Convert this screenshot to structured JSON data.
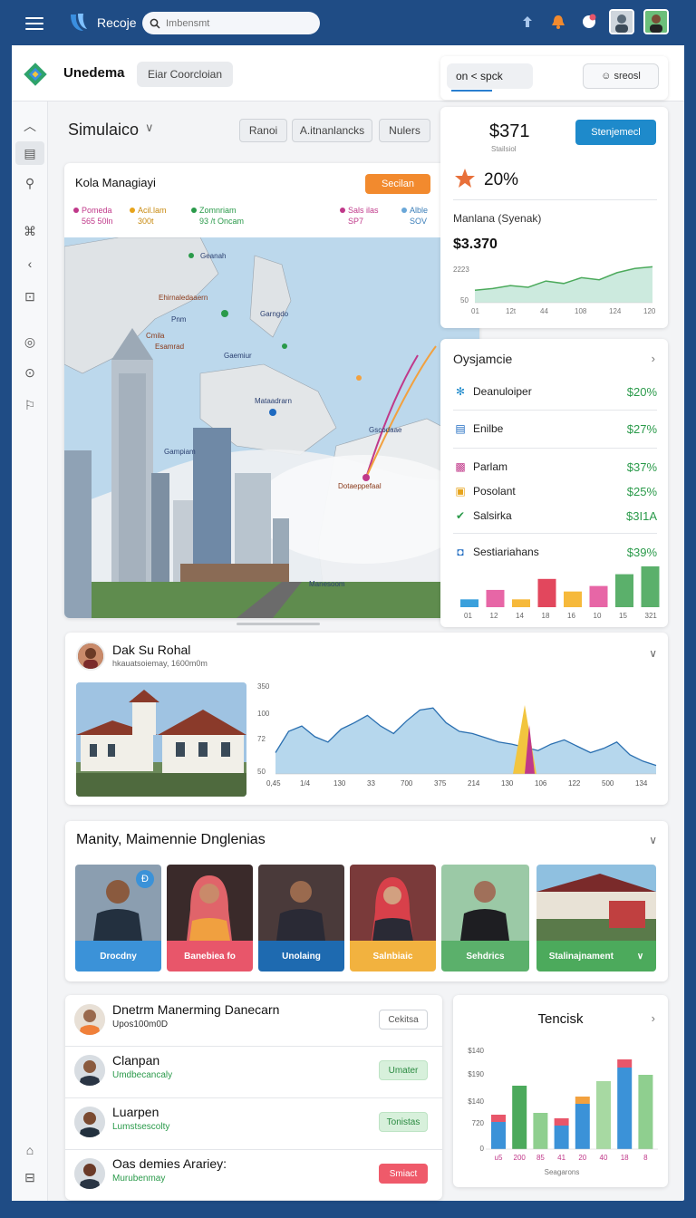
{
  "topbar": {
    "brand": "Recoje",
    "search_placeholder": "Imbensmt"
  },
  "header": {
    "title": "Unedema",
    "tab": "Eiar Coorcloian"
  },
  "page": {
    "title": "Simulaico",
    "filters": [
      "Ranoi",
      "A.itnanlancks",
      "Nulers"
    ]
  },
  "map_card": {
    "title": "Kola Managiayi",
    "button": "Secilan",
    "legend": [
      {
        "label": "Pomeda",
        "value": "565 50ln",
        "color": "#c0398a"
      },
      {
        "label": "Acil.lam",
        "value": "300t",
        "color": "#e7a41c"
      },
      {
        "label": "Zomnriam",
        "value": "93 /t Oncam",
        "color": "#2a9a4a"
      },
      {
        "label": "Sals ilas",
        "value": "SP7",
        "color": "#c0398a"
      },
      {
        "label": "Alble",
        "value": "SOV",
        "color": "#6aa7d8"
      }
    ],
    "labels": [
      "Geanah",
      "Ehirnaledaaern",
      "Pnm",
      "Garngdo",
      "Cmila",
      "Esamrad",
      "Gaemiur",
      "Mataadrarn",
      "Gscodaae",
      "Gampiam",
      "Dotaeppefaal",
      "Manesoom"
    ]
  },
  "right_tabs": {
    "tab": "on  < spck",
    "select": "☺ sreosl"
  },
  "stat_card": {
    "big_value": "$371",
    "big_sub": "Stailsiol",
    "button": "Stenjemecl",
    "percent": "20%",
    "label": "Manlana (Syenak)",
    "value": "$3.370",
    "y_ticks": [
      "2223",
      "50"
    ],
    "x_ticks": [
      "01",
      "12t",
      "44",
      "108",
      "124",
      "120"
    ],
    "series": [
      30,
      34,
      41,
      37,
      52,
      46,
      60,
      55,
      72,
      82,
      86
    ]
  },
  "list_card": {
    "title": "Oysjamcie",
    "items": [
      {
        "icon": "✻",
        "icon_color": "#1e8acb",
        "label": "Deanuloiper",
        "value": "$20%"
      },
      {
        "icon": "▤",
        "icon_color": "#1e6ac0",
        "label": "Enilbe",
        "value": "$27%"
      },
      {
        "icon": "▩",
        "icon_color": "#c0398a",
        "label": "Parlam",
        "value": "$37%"
      },
      {
        "icon": "▣",
        "icon_color": "#e7a41c",
        "label": "Posolant",
        "value": "$25%"
      },
      {
        "icon": "✔",
        "icon_color": "#2a9a4a",
        "label": "Salsirka",
        "value": "$3I1A"
      },
      {
        "icon": "◘",
        "icon_color": "#1e6ac0",
        "label": "Sestiariahans",
        "value": "$39%"
      }
    ],
    "x_ticks": [
      "01",
      "12",
      "14",
      "18",
      "16",
      "10",
      "15",
      "321"
    ],
    "bars": [
      {
        "v": 10,
        "c": "#3aa0dc"
      },
      {
        "v": 22,
        "c": "#e766a6"
      },
      {
        "v": 10,
        "c": "#f6b93b"
      },
      {
        "v": 36,
        "c": "#e2475d"
      },
      {
        "v": 20,
        "c": "#f6b93b"
      },
      {
        "v": 27,
        "c": "#e766a6"
      },
      {
        "v": 42,
        "c": "#5bb06b"
      },
      {
        "v": 52,
        "c": "#5bb06b"
      }
    ]
  },
  "profile_card": {
    "name": "Dak Su Rohal",
    "sub": "hkauatsoiemay, 1600m0m",
    "y_ticks": [
      "350",
      "100",
      "72",
      "50"
    ],
    "x_ticks": [
      "0,45",
      "1/4",
      "130",
      "33",
      "700",
      "375",
      "214",
      "130",
      "106",
      "122",
      "500",
      "134"
    ],
    "series": [
      20,
      40,
      45,
      35,
      30,
      42,
      48,
      55,
      45,
      38,
      50,
      60,
      62,
      48,
      40,
      38,
      34,
      30,
      28,
      25,
      22,
      28,
      32,
      26,
      20,
      24,
      30,
      18,
      12,
      8
    ]
  },
  "team_card": {
    "title": "Manity, Maimennie Dnglenias",
    "members": [
      {
        "label": "Drocdny",
        "color": "#3b92d8"
      },
      {
        "label": "Banebiea fo",
        "color": "#e8566a"
      },
      {
        "label": "Unolaing",
        "color": "#1e6ab0"
      },
      {
        "label": "Salnbiaic",
        "color": "#f2b23f"
      },
      {
        "label": "Sehdrics",
        "color": "#5bb06b"
      },
      {
        "label": "Stalinajnament",
        "color": "#4caa5c"
      }
    ]
  },
  "people": [
    {
      "name": "Dnetrm Manerming Danecarn",
      "sub": "Upos100m0D",
      "tag": "Cekitsa",
      "tag_bg": "#ffffff",
      "tag_fg": "#555555",
      "tag_border": "#cfd3d8"
    },
    {
      "name": "Clanpan",
      "sub": "Umdbecancaly",
      "tag": "Umater",
      "tag_bg": "#d7f0db",
      "tag_fg": "#2a8a40",
      "tag_border": "#bde3c4"
    },
    {
      "name": "Luarpen",
      "sub": "Lumstsescolty",
      "tag": "Tonistas",
      "tag_bg": "#d7f0db",
      "tag_fg": "#2a8a40",
      "tag_border": "#bde3c4"
    },
    {
      "name": "Oas demies Arariey:",
      "sub": "Murubenmay",
      "tag": "Smiact",
      "tag_bg": "#ef5a6a",
      "tag_fg": "#ffffff",
      "tag_border": "#ef5a6a"
    }
  ],
  "bar_card": {
    "title": "Tencisk",
    "y_ticks": [
      "$140",
      "$190",
      "$140",
      "720",
      "0"
    ],
    "x_ticks": [
      "u5",
      "200",
      "85",
      "41",
      "20",
      "40",
      "18",
      "8"
    ],
    "xlabel": "Seagarons",
    "bars": [
      {
        "v": 30,
        "top": 8,
        "c": "#3b92d8",
        "tc": "#e8566a"
      },
      {
        "v": 70,
        "top": 0,
        "c": "#4caa5c",
        "tc": "#4caa5c"
      },
      {
        "v": 40,
        "top": 0,
        "c": "#8fcf8f",
        "tc": "#8fcf8f"
      },
      {
        "v": 26,
        "top": 8,
        "c": "#3b92d8",
        "tc": "#e8566a"
      },
      {
        "v": 50,
        "top": 8,
        "c": "#3b92d8",
        "tc": "#f2a13f"
      },
      {
        "v": 75,
        "top": 0,
        "c": "#a7d9a2",
        "tc": "#a7d9a2"
      },
      {
        "v": 90,
        "top": 9,
        "c": "#3b92d8",
        "tc": "#e8566a"
      },
      {
        "v": 82,
        "top": 0,
        "c": "#8fcf8f",
        "tc": "#8fcf8f"
      }
    ]
  },
  "colors": {
    "brand_blue": "#1f4c85",
    "accent_orange": "#f28a2e",
    "accent_blue": "#1e8acb",
    "positive_green": "#2a9a4a"
  }
}
